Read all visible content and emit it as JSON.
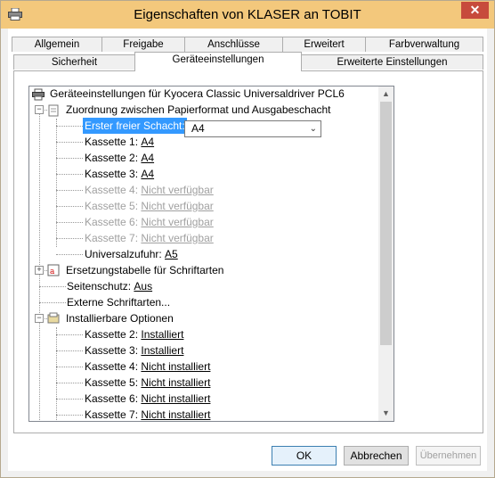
{
  "window": {
    "title": "Eigenschaften von KLASER an TOBIT",
    "close_glyph": "✕"
  },
  "tabs": {
    "row1": [
      "Allgemein",
      "Freigabe",
      "Anschlüsse",
      "Erweitert",
      "Farbverwaltung"
    ],
    "row2": [
      "Sicherheit",
      "Geräteeinstellungen",
      "Erweiterte Einstellungen"
    ],
    "active": "Geräteeinstellungen"
  },
  "tree": {
    "root": "Geräteeinstellungen für Kyocera Classic Universaldriver PCL6",
    "paper_group": "Zuordnung zwischen Papierformat und Ausgabeschacht",
    "first_tray": {
      "label": "Erster freier Schacht:",
      "value": "A4"
    },
    "trays": [
      {
        "label": "Kassette 1:",
        "value": "A4",
        "disabled": false
      },
      {
        "label": "Kassette 2:",
        "value": "A4",
        "disabled": false
      },
      {
        "label": "Kassette 3:",
        "value": "A4",
        "disabled": false
      },
      {
        "label": "Kassette 4:",
        "value": "Nicht verfügbar",
        "disabled": true
      },
      {
        "label": "Kassette 5:",
        "value": "Nicht verfügbar",
        "disabled": true
      },
      {
        "label": "Kassette 6:",
        "value": "Nicht verfügbar",
        "disabled": true
      },
      {
        "label": "Kassette 7:",
        "value": "Nicht verfügbar",
        "disabled": true
      },
      {
        "label": "Universalzufuhr:",
        "value": "A5",
        "disabled": false
      }
    ],
    "font_table": "Ersetzungstabelle für Schriftarten",
    "page_protect": {
      "label": "Seitenschutz:",
      "value": "Aus"
    },
    "ext_fonts": "Externe Schriftarten...",
    "options_group": "Installierbare Optionen",
    "options": [
      {
        "label": "Kassette 2:",
        "value": "Installiert"
      },
      {
        "label": "Kassette 3:",
        "value": "Installiert"
      },
      {
        "label": "Kassette 4:",
        "value": "Nicht installiert"
      },
      {
        "label": "Kassette 5:",
        "value": "Nicht installiert"
      },
      {
        "label": "Kassette 6:",
        "value": "Nicht installiert"
      },
      {
        "label": "Kassette 7:",
        "value": "Nicht installiert"
      }
    ]
  },
  "buttons": {
    "ok": "OK",
    "cancel": "Abbrechen",
    "apply": "Übernehmen"
  },
  "icons": {
    "printer": "printer-icon",
    "paper": "paper-icon",
    "font": "font-table-icon",
    "options": "options-icon"
  },
  "colors": {
    "titlebar": "#f3c87c",
    "close": "#c74b3c",
    "selection": "#3399ff"
  }
}
